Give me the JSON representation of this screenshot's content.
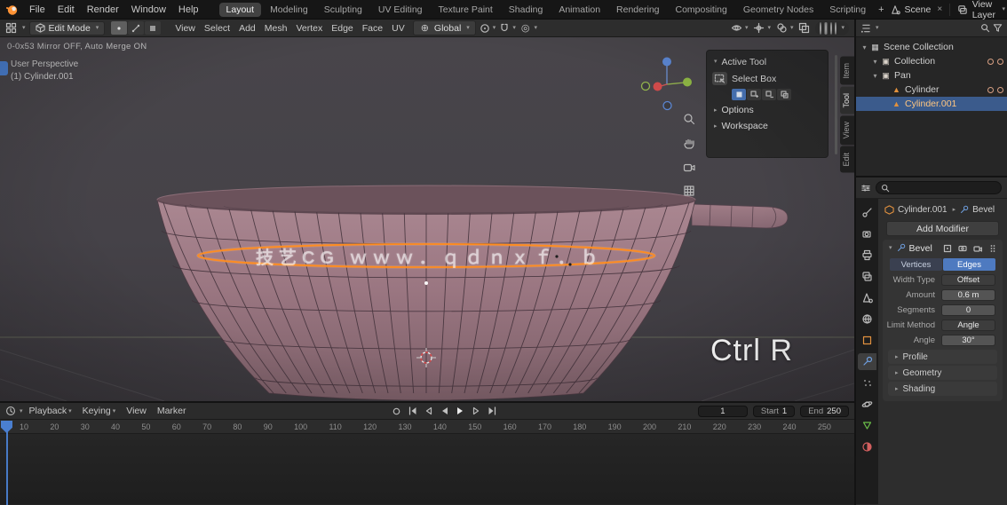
{
  "icons": {
    "chevron_down": "▾",
    "chevron_right": "▸",
    "close": "×",
    "plus": "+",
    "proportional": "◎",
    "orientation_globe": "⊕"
  },
  "topbar": {
    "menus": [
      "File",
      "Edit",
      "Render",
      "Window",
      "Help"
    ],
    "tabs": [
      {
        "label": "Layout",
        "active": true
      },
      {
        "label": "Modeling"
      },
      {
        "label": "Sculpting"
      },
      {
        "label": "UV Editing"
      },
      {
        "label": "Texture Paint"
      },
      {
        "label": "Shading"
      },
      {
        "label": "Animation"
      },
      {
        "label": "Rendering"
      },
      {
        "label": "Compositing"
      },
      {
        "label": "Geometry Nodes"
      },
      {
        "label": "Scripting"
      }
    ],
    "add_workspace": "+",
    "scene_name": "Scene",
    "view_layer_name": "View Layer"
  },
  "viewport_header": {
    "mode": "Edit Mode",
    "menus": [
      "View",
      "Select",
      "Add",
      "Mesh",
      "Vertex",
      "Edge",
      "Face",
      "UV"
    ],
    "orientation": "Global"
  },
  "viewport": {
    "stats_line": "0-0x53   Mirror OFF,  Auto Merge ON",
    "view_name": "User Perspective",
    "active_object": "(1) Cylinder.001",
    "watermark": "技艺CG ｗｗｗ．ｑｄｎｘｆ．ｂ",
    "key_overlay": "Ctrl R"
  },
  "tool_panel": {
    "header": "Active Tool",
    "tool_name": "Select Box",
    "collapsed": [
      "Options",
      "Workspace"
    ]
  },
  "sidebar_tabs": [
    {
      "label": "Item"
    },
    {
      "label": "Tool",
      "active": true
    },
    {
      "label": "View"
    },
    {
      "label": "Edit"
    }
  ],
  "outliner": {
    "rows": [
      {
        "label": "Scene Collection",
        "depth": 0,
        "glyph": "▦",
        "icon": "scene-collection",
        "expander": "▾"
      },
      {
        "label": "Collection",
        "depth": 1,
        "glyph": "▣",
        "icon": "collection",
        "expander": "▾",
        "toggles": true
      },
      {
        "label": "Pan",
        "depth": 1,
        "glyph": "▣",
        "icon": "collection",
        "expander": "▾"
      },
      {
        "label": "Cylinder",
        "depth": 2,
        "glyph": "▲",
        "icon": "mesh",
        "expander": "",
        "toggles": true
      },
      {
        "label": "Cylinder.001",
        "depth": 2,
        "glyph": "▲",
        "icon": "mesh",
        "expander": "",
        "selected": true
      }
    ]
  },
  "properties": {
    "breadcrumb_object": "Cylinder.001",
    "breadcrumb_modifier": "Bevel",
    "add_modifier": "Add Modifier",
    "modifier_name": "Bevel",
    "affect": [
      {
        "label": "Vertices"
      },
      {
        "label": "Edges",
        "active": true
      }
    ],
    "fields": [
      {
        "label": "Width Type",
        "value": "Offset",
        "type": "dropdown"
      },
      {
        "label": "Amount",
        "value": "0.6 m",
        "type": "slider"
      },
      {
        "label": "Segments",
        "value": "0",
        "type": "slider"
      },
      {
        "label": "Limit Method",
        "value": "Angle",
        "type": "dropdown"
      },
      {
        "label": "Angle",
        "value": "30°",
        "type": "slider"
      }
    ],
    "collapsed_sections": [
      "Profile",
      "Geometry",
      "Shading"
    ]
  },
  "timeline": {
    "menus": [
      "Playback",
      "Keying",
      "View",
      "Marker"
    ],
    "current_frame": "1",
    "start_label": "Start",
    "start_value": "1",
    "end_label": "End",
    "end_value": "250",
    "ticks": [
      "10",
      "20",
      "30",
      "40",
      "50",
      "60",
      "70",
      "80",
      "90",
      "100",
      "110",
      "120",
      "130",
      "140",
      "150",
      "160",
      "170",
      "180",
      "190",
      "200",
      "210",
      "220",
      "230",
      "240",
      "250"
    ]
  }
}
